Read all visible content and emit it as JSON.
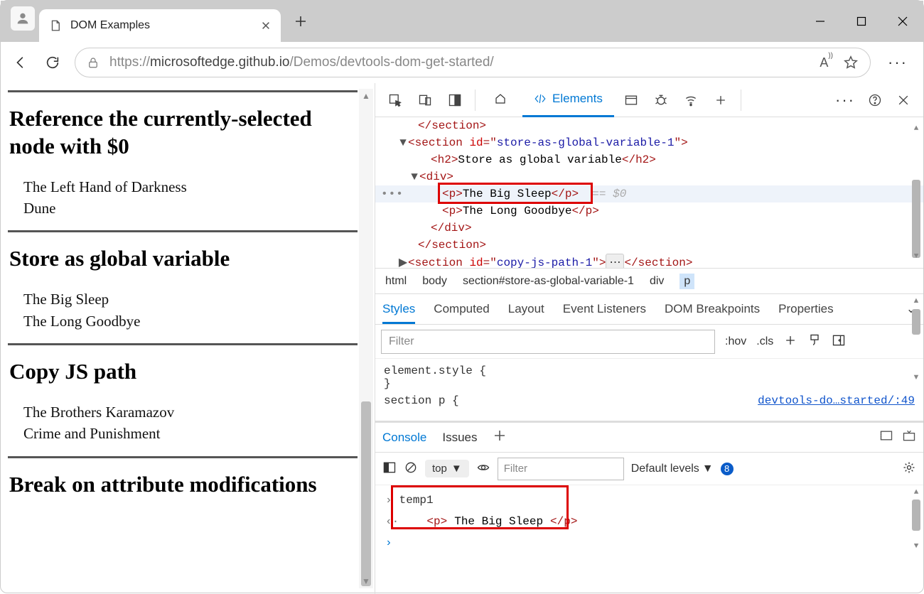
{
  "browser": {
    "tab_title": "DOM Examples",
    "url_prefix": "https://",
    "url_host": "microsoftedge.github.io",
    "url_path": "/Demos/devtools-dom-get-started/"
  },
  "page": {
    "sections": [
      {
        "title": "Reference the currently-selected node with $0",
        "items": [
          "The Left Hand of Darkness",
          "Dune"
        ]
      },
      {
        "title": "Store as global variable",
        "items": [
          "The Big Sleep",
          "The Long Goodbye"
        ]
      },
      {
        "title": "Copy JS path",
        "items": [
          "The Brothers Karamazov",
          "Crime and Punishment"
        ]
      },
      {
        "title": "Break on attribute modifications",
        "items": []
      }
    ]
  },
  "devtools": {
    "active_tab": "Elements",
    "tree": {
      "close_section_1": "</section>",
      "open_section_attr_id": "store-as-global-variable-1",
      "h2_text": "Store as global variable",
      "div_open": "<div>",
      "p_selected": "The Big Sleep",
      "selected_marker": "== $0",
      "p2": "The Long Goodbye",
      "div_close": "</div>",
      "close_section_2": "</section>",
      "section3_id": "copy-js-path-1"
    },
    "breadcrumb": [
      "html",
      "body",
      "section#store-as-global-variable-1",
      "div",
      "p"
    ],
    "styles": {
      "tabs": [
        "Styles",
        "Computed",
        "Layout",
        "Event Listeners",
        "DOM Breakpoints",
        "Properties"
      ],
      "filter_placeholder": "Filter",
      "hov": ":hov",
      "cls": ".cls",
      "element_style": "element.style {",
      "element_style_close": "}",
      "selector": "section p {",
      "source_link": "devtools-do…started/:49"
    },
    "drawer": {
      "tabs": [
        "Console",
        "Issues"
      ],
      "context": "top",
      "filter_placeholder": "Filter",
      "levels": "Default levels",
      "issue_count": "8",
      "input1": "temp1",
      "output_tag_open": "<p>",
      "output_text": "The Big Sleep",
      "output_tag_close": "</p>"
    }
  }
}
